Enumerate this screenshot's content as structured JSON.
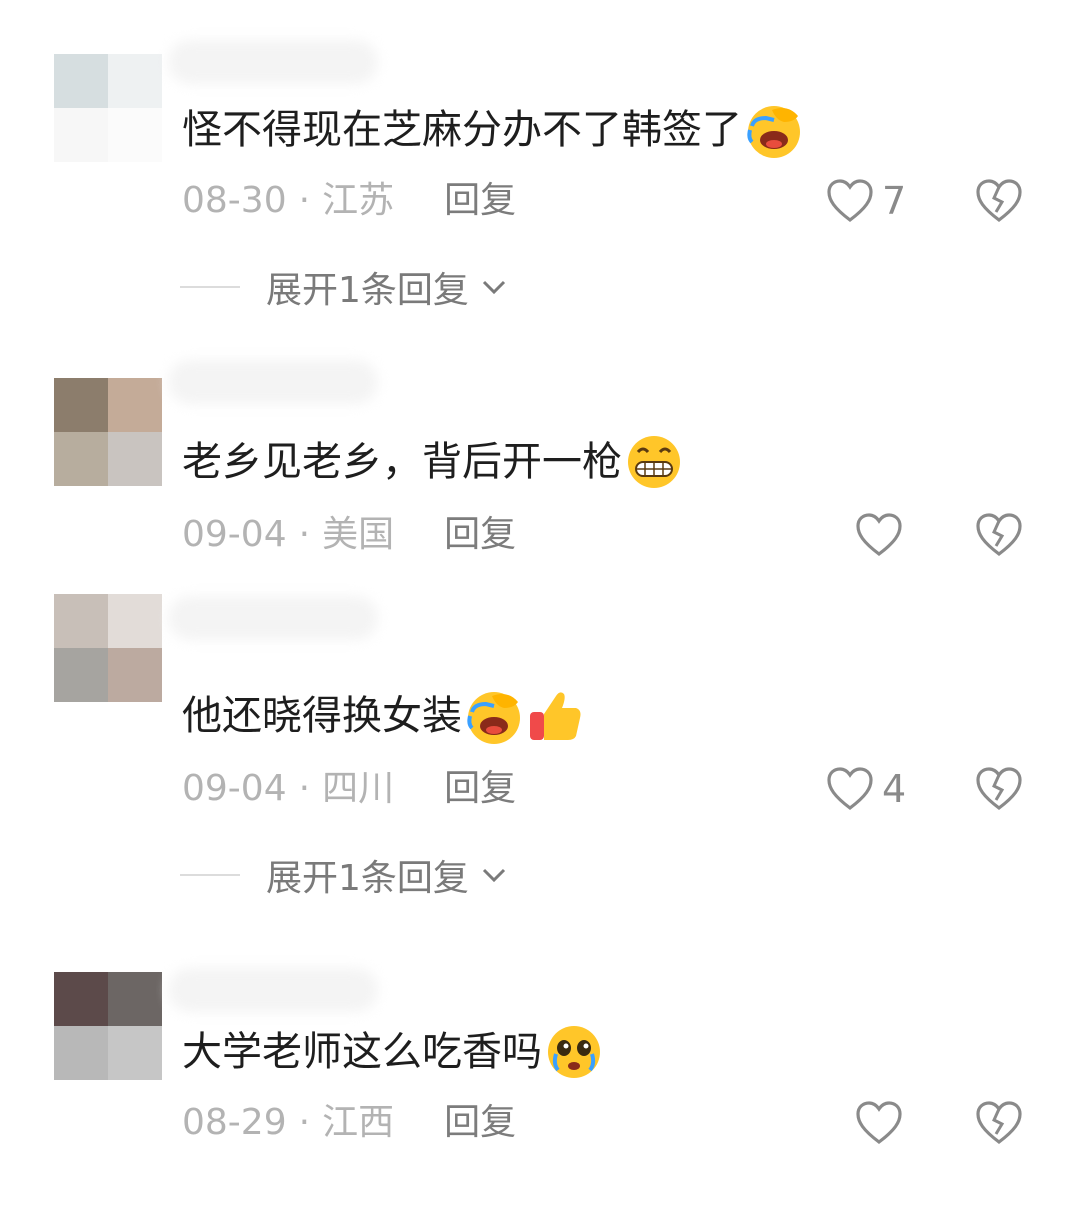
{
  "colors": {
    "text": "#1e1e1e",
    "meta": "#b3b3b3",
    "reply": "#7c7c7c",
    "icon": "#8a8a8a"
  },
  "comments": [
    {
      "text": "怪不得现在芝麻分办不了韩签了",
      "emojis": [
        "facepalm-crying-emoji"
      ],
      "date": "08-30",
      "location": "江苏",
      "reply_label": "回复",
      "likes": "7",
      "expand_label": "展开1条回复"
    },
    {
      "text": "老乡见老乡，背后开一枪",
      "emojis": [
        "grin-emoji"
      ],
      "date": "09-04",
      "location": "美国",
      "reply_label": "回复",
      "likes": "",
      "expand_label": ""
    },
    {
      "text": "他还晓得换女装",
      "emojis": [
        "facepalm-crying-emoji",
        "thumbs-up-emoji"
      ],
      "date": "09-04",
      "location": "四川",
      "reply_label": "回复",
      "likes": "4",
      "expand_label": "展开1条回复"
    },
    {
      "text": "大学老师这么吃香吗",
      "emojis": [
        "teary-eyed-emoji"
      ],
      "date": "08-29",
      "location": "江西",
      "reply_label": "回复",
      "likes": "",
      "expand_label": ""
    }
  ]
}
